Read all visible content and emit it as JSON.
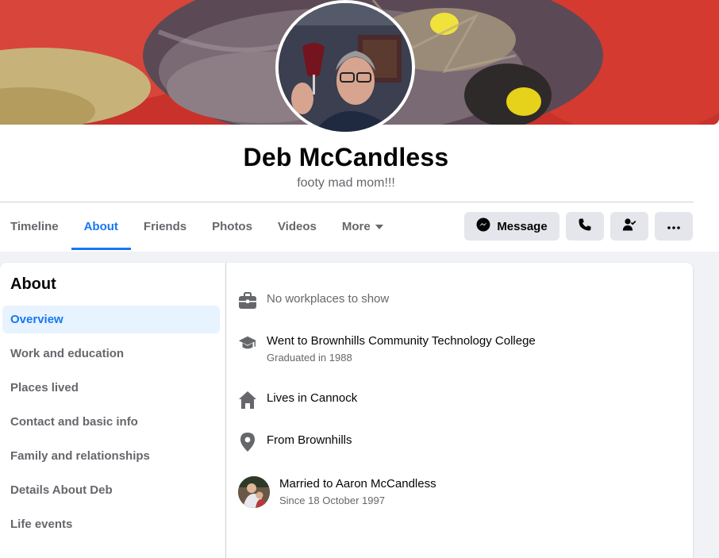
{
  "profile": {
    "name": "Deb McCandless",
    "bio": "footy mad mom!!!"
  },
  "tabs": [
    {
      "label": "Timeline",
      "active": false
    },
    {
      "label": "About",
      "active": true
    },
    {
      "label": "Friends",
      "active": false
    },
    {
      "label": "Photos",
      "active": false
    },
    {
      "label": "Videos",
      "active": false
    },
    {
      "label": "More",
      "active": false
    }
  ],
  "actions": {
    "message_label": "Message",
    "call_icon": "phone-icon",
    "friend_icon": "friend-check-icon",
    "more_icon": "ellipsis-icon"
  },
  "about": {
    "title": "About",
    "nav": [
      {
        "label": "Overview",
        "active": true
      },
      {
        "label": "Work and education",
        "active": false
      },
      {
        "label": "Places lived",
        "active": false
      },
      {
        "label": "Contact and basic info",
        "active": false
      },
      {
        "label": "Family and relationships",
        "active": false
      },
      {
        "label": "Details About Deb",
        "active": false
      },
      {
        "label": "Life events",
        "active": false
      }
    ],
    "overview": {
      "work": {
        "text": "No workplaces to show",
        "icon": "briefcase-icon"
      },
      "education": {
        "text": "Went to Brownhills Community Technology College",
        "sub": "Graduated in 1988",
        "icon": "graduation-cap-icon"
      },
      "lives": {
        "text": "Lives in Cannock",
        "icon": "home-icon"
      },
      "from": {
        "text": "From Brownhills",
        "icon": "location-pin-icon"
      },
      "relationship": {
        "text": "Married to Aaron McCandless",
        "sub": "Since 18 October 1997"
      }
    }
  },
  "colors": {
    "accent": "#1877f2",
    "accent_bg": "#e7f3ff",
    "button_bg": "#e4e6eb",
    "muted_text": "#65676b",
    "page_bg": "#f0f2f5"
  }
}
